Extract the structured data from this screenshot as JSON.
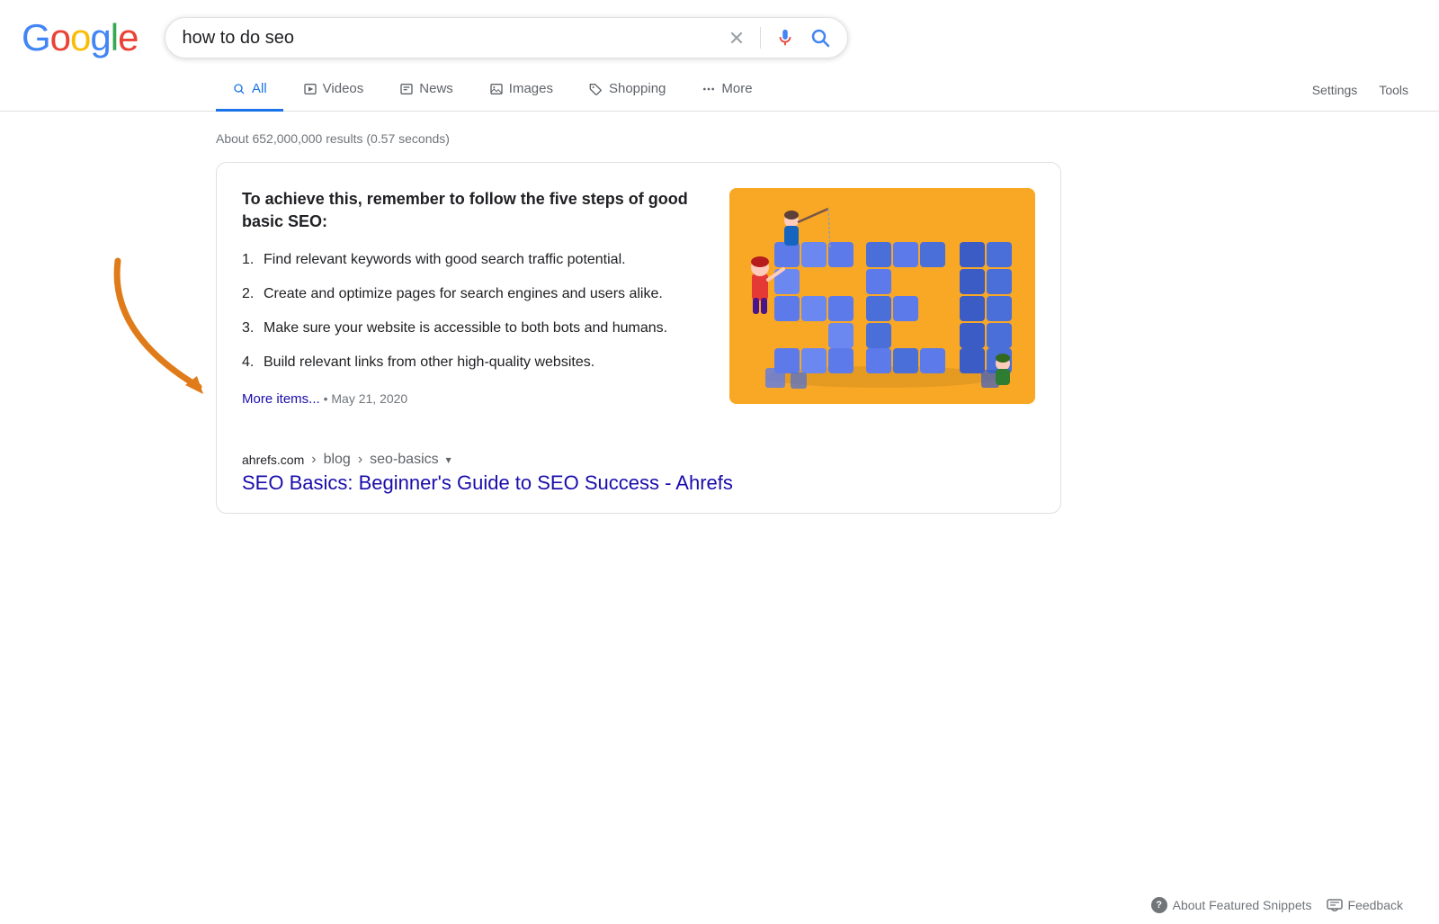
{
  "logo": {
    "letters": [
      {
        "char": "G",
        "color": "#4285F4"
      },
      {
        "char": "o",
        "color": "#EA4335"
      },
      {
        "char": "o",
        "color": "#FBBC05"
      },
      {
        "char": "g",
        "color": "#4285F4"
      },
      {
        "char": "l",
        "color": "#34A853"
      },
      {
        "char": "e",
        "color": "#EA4335"
      }
    ]
  },
  "search": {
    "query": "how to do seo",
    "placeholder": "Search"
  },
  "nav": {
    "tabs": [
      {
        "id": "all",
        "label": "All",
        "icon": "search",
        "active": true
      },
      {
        "id": "videos",
        "label": "Videos",
        "icon": "play"
      },
      {
        "id": "news",
        "label": "News",
        "icon": "news"
      },
      {
        "id": "images",
        "label": "Images",
        "icon": "image"
      },
      {
        "id": "shopping",
        "label": "Shopping",
        "icon": "tag"
      },
      {
        "id": "more",
        "label": "More",
        "icon": "dots"
      }
    ],
    "settings": "Settings",
    "tools": "Tools"
  },
  "results": {
    "count": "About 652,000,000 results (0.57 seconds)"
  },
  "featured_snippet": {
    "title": "To achieve this, remember to follow the five steps of good basic SEO:",
    "items": [
      "Find relevant keywords with good search traffic potential.",
      "Create and optimize pages for search engines and users alike.",
      "Make sure your website is accessible to both bots and humans.",
      "Build relevant links from other high-quality websites."
    ],
    "more_items_label": "More items...",
    "date": "May 21, 2020",
    "source_url": "ahrefs.com",
    "breadcrumb1": "blog",
    "breadcrumb2": "seo-basics",
    "result_title": "SEO Basics: Beginner's Guide to SEO Success - Ahrefs"
  },
  "bottom": {
    "about_snippets": "About Featured Snippets",
    "feedback": "Feedback"
  },
  "colors": {
    "accent_blue": "#1a73e8",
    "link_blue": "#1a0dab",
    "orange_arrow": "#E07B1A"
  }
}
